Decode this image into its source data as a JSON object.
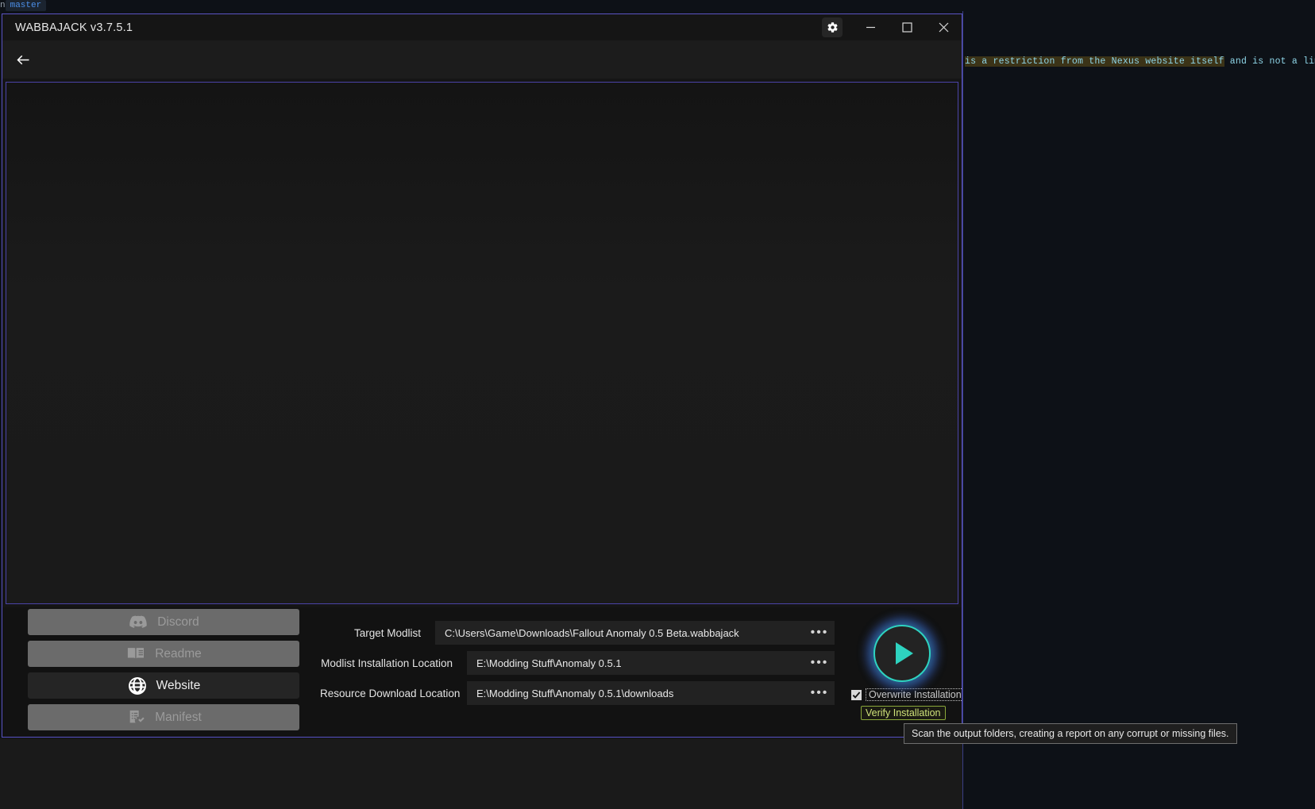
{
  "background": {
    "editor_prefix": "n",
    "branch": "master",
    "console_text_prefix": "is a restriction from the Nexus website itself",
    "console_text_suffix": " and is not a limi"
  },
  "window": {
    "title": "WABBAJACK v3.7.5.1",
    "controls": {
      "settings": "gear-icon",
      "minimize": "minimize-icon",
      "maximize": "maximize-icon",
      "close": "close-icon"
    },
    "nav": {
      "back": "back-arrow-icon"
    }
  },
  "side_buttons": [
    {
      "label": "Discord",
      "icon": "discord-icon",
      "enabled": false
    },
    {
      "label": "Readme",
      "icon": "readme-icon",
      "enabled": false
    },
    {
      "label": "Website",
      "icon": "globe-icon",
      "enabled": true
    },
    {
      "label": "Manifest",
      "icon": "manifest-icon",
      "enabled": false
    }
  ],
  "form": {
    "rows": [
      {
        "label": "Target Modlist",
        "value": "C:\\Users\\Game\\Downloads\\Fallout Anomaly 0.5 Beta.wabbajack",
        "browse": "•••"
      },
      {
        "label": "Modlist Installation Location",
        "value": "E:\\Modding Stuff\\Anomaly 0.5.1",
        "browse": "•••"
      },
      {
        "label": "Resource Download Location",
        "value": "E:\\Modding Stuff\\Anomaly 0.5.1\\downloads",
        "browse": "•••"
      }
    ]
  },
  "actions": {
    "play_button": "play-icon",
    "overwrite_label": "Overwrite Installation",
    "overwrite_checked": true,
    "verify_label": "Verify Installation"
  },
  "tooltip": {
    "text": "Scan the output folders, creating a report on any corrupt or missing files."
  },
  "colors": {
    "accent_teal": "#2ed3c0",
    "window_border": "#5b54c4",
    "panel_border": "#4b44a8",
    "verify_green": "#8aa83a"
  }
}
